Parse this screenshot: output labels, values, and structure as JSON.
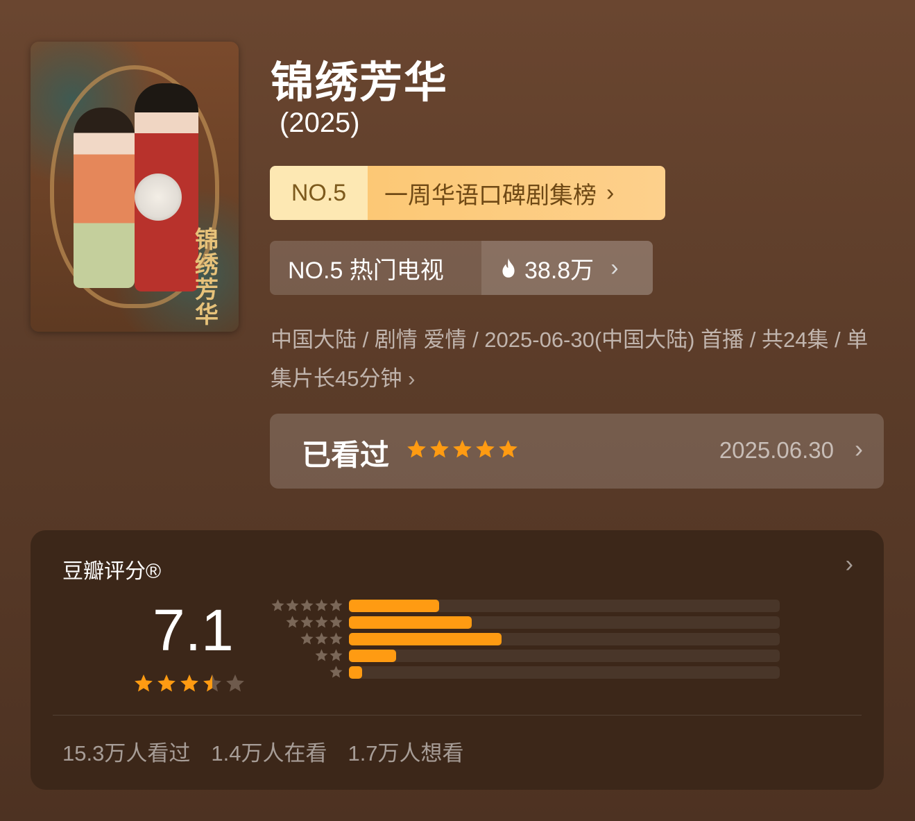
{
  "poster": {
    "caption": "锦绣芳华"
  },
  "title": "锦绣芳华",
  "year": "(2025)",
  "ranking": {
    "no": "NO.5",
    "label": "一周华语口碑剧集榜",
    "chevron": "›"
  },
  "hot": {
    "label": "NO.5 热门电视",
    "count": "38.8万",
    "icon": "flame-icon",
    "chevron": "›"
  },
  "meta": {
    "text": "中国大陆 / 剧情 爱情 / 2025-06-30(中国大陆) 首播 / 共24集 / 单集片长45分钟",
    "chevron": "›"
  },
  "watched": {
    "label": "已看过",
    "user_rating_stars": 5,
    "date": "2025.06.30",
    "chevron": "›"
  },
  "rating_card": {
    "heading": "豆瓣评分®",
    "chevron": "›",
    "score": "7.1",
    "score_stars": 3.5,
    "distribution": [
      {
        "stars": 5,
        "fraction": 0.21
      },
      {
        "stars": 4,
        "fraction": 0.285
      },
      {
        "stars": 3,
        "fraction": 0.355
      },
      {
        "stars": 2,
        "fraction": 0.11
      },
      {
        "stars": 1,
        "fraction": 0.03
      }
    ],
    "counts": [
      "15.3万人看过",
      "1.4万人在看",
      "1.7万人想看"
    ]
  },
  "colors": {
    "accent": "#ff9b12",
    "badge_gold": "#fcc875",
    "card_bg": "#3c2719"
  }
}
